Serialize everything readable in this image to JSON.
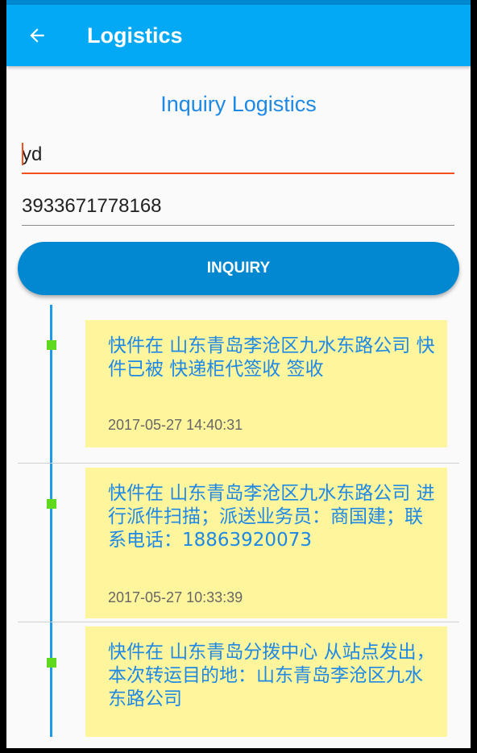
{
  "appbar": {
    "title": "Logistics",
    "back_icon": "arrow-left-icon"
  },
  "form": {
    "heading": "Inquiry Logistics",
    "company_value": "yd",
    "tracking_value": "3933671778168",
    "inquiry_label": "INQUIRY"
  },
  "colors": {
    "appbar": "#03a9f4",
    "statusbar": "#0288d1",
    "button": "#0288d1",
    "heading": "#1e88e5",
    "focused_underline": "#f4511e",
    "timeline": "#1e9be8",
    "timeline_dot": "#5fd81d",
    "card": "#fff59d"
  },
  "timeline": [
    {
      "message": "快件在 山东青岛李沧区九水东路公司 快件已被 快递柜代签收 签收",
      "time": "2017-05-27 14:40:31"
    },
    {
      "message": "快件在 山东青岛李沧区九水东路公司 进行派件扫描；派送业务员：商国建；联系电话：18863920073",
      "time": "2017-05-27 10:33:39"
    },
    {
      "message": "快件在 山东青岛分拨中心 从站点发出，本次转运目的地：山东青岛李沧区九水东路公司",
      "time": ""
    }
  ]
}
